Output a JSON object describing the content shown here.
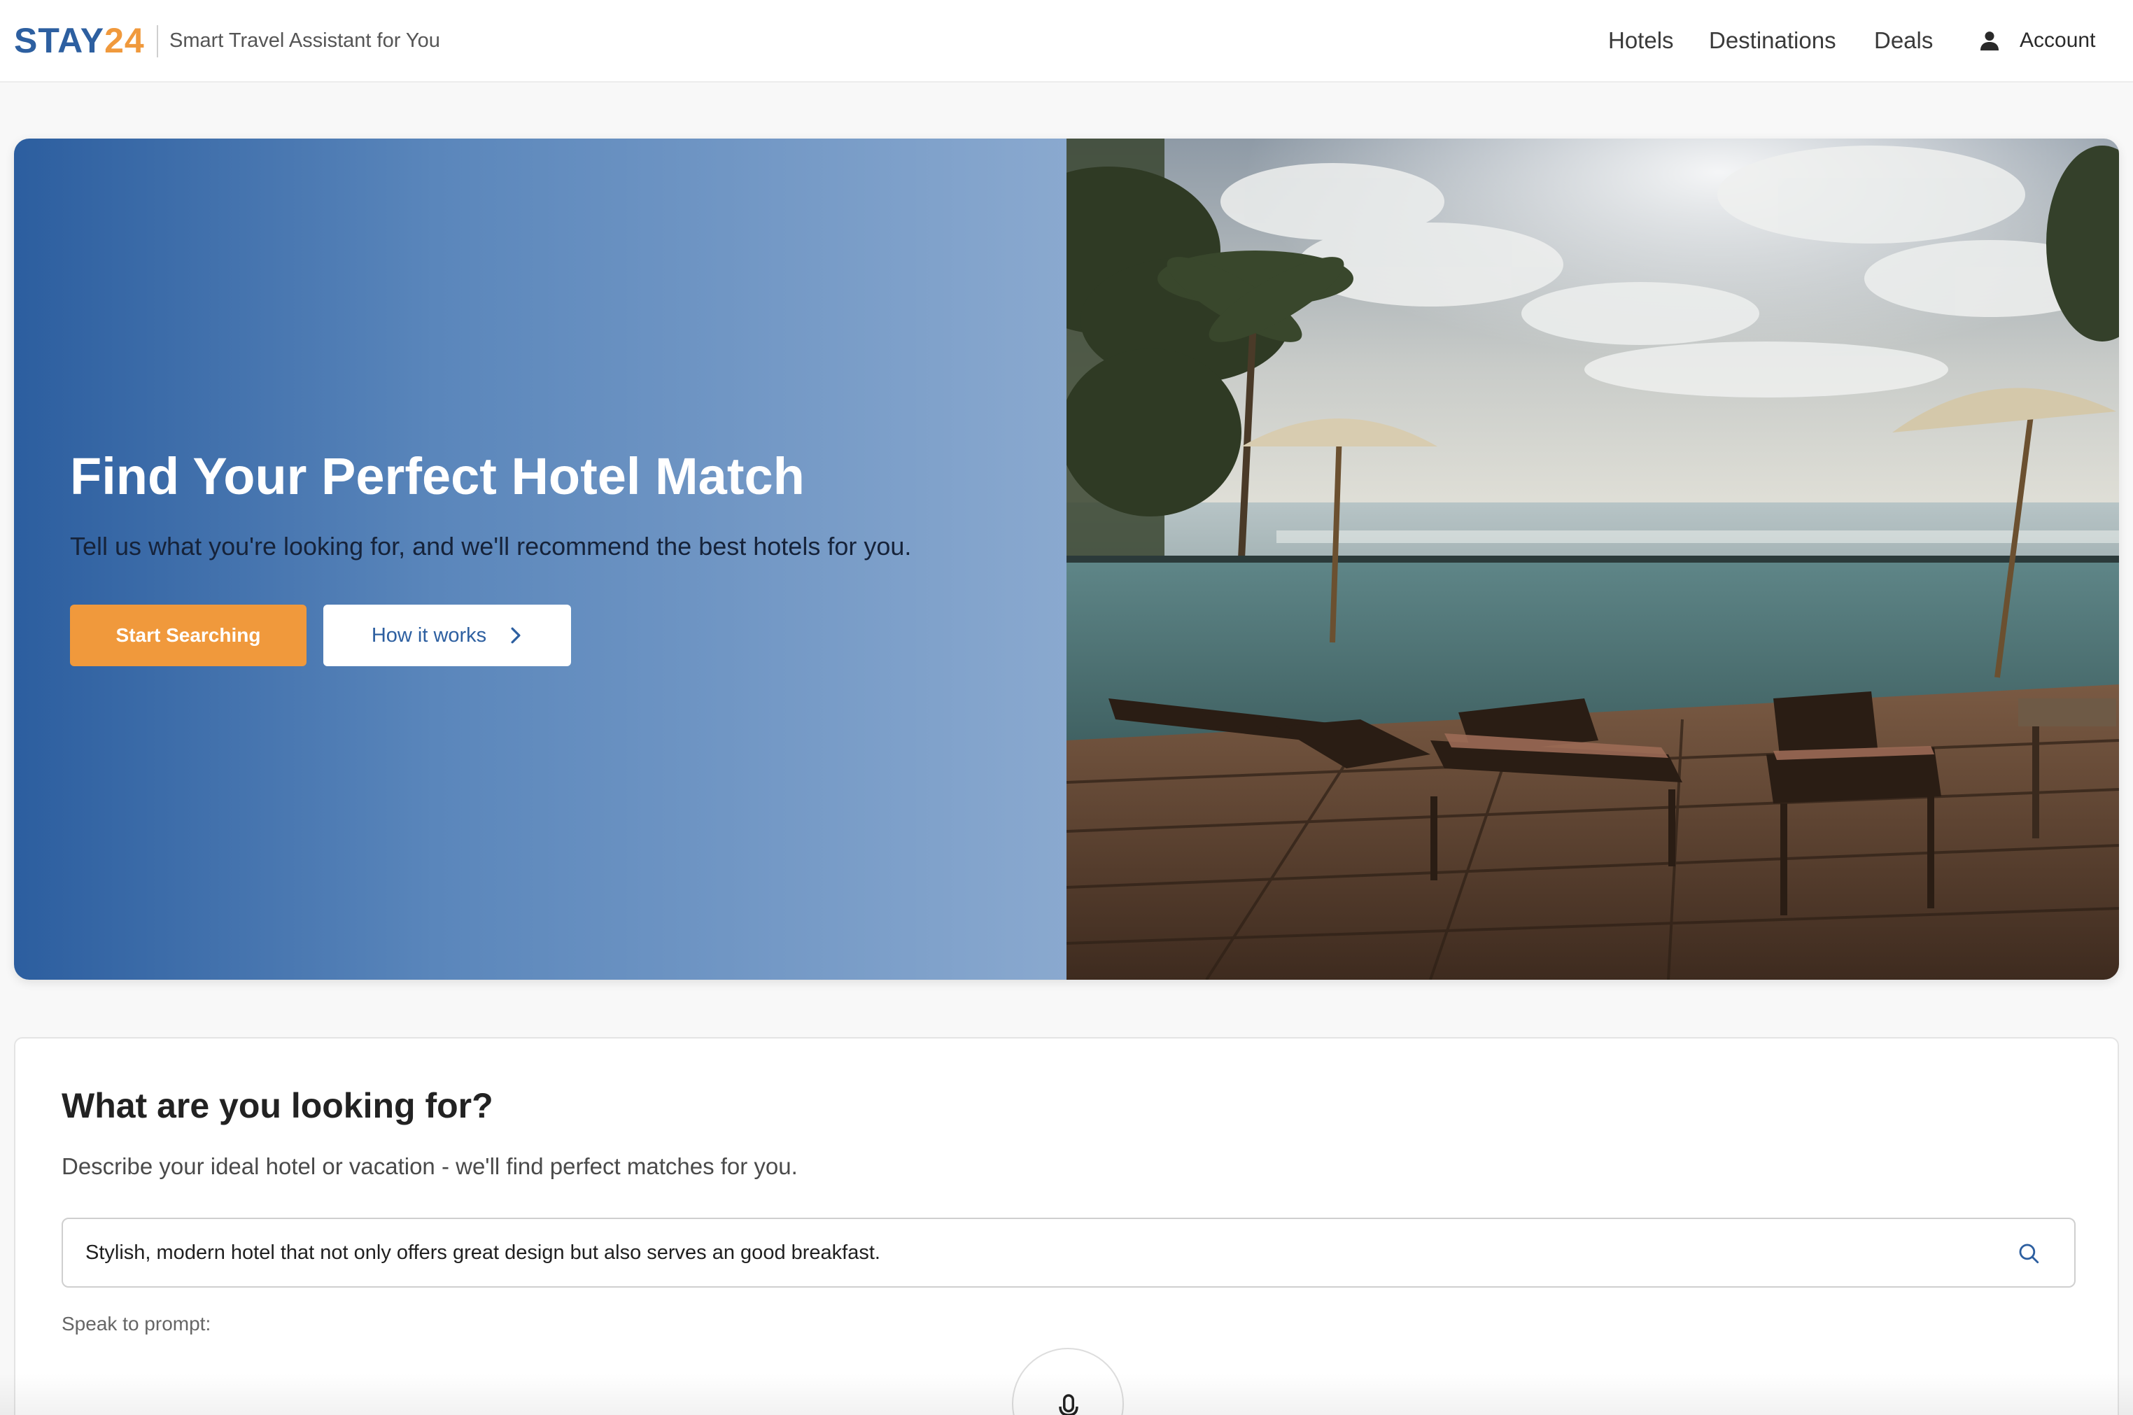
{
  "header": {
    "logo_part1": "STAY",
    "logo_part2": "24",
    "tagline": "Smart Travel Assistant for You",
    "nav": {
      "hotels": "Hotels",
      "destinations": "Destinations",
      "deals": "Deals"
    },
    "account_label": "Account",
    "account_icon": "user-icon"
  },
  "hero": {
    "title": "Find Your Perfect Hotel Match",
    "subtitle": "Tell us what you're looking for, and we'll recommend the best hotels for you.",
    "primary_button": "Start Searching",
    "secondary_button": "How it works",
    "secondary_button_icon": "chevron-right-icon",
    "image": "beach-resort-pool-deck-photo"
  },
  "search_card": {
    "title": "What are you looking for?",
    "description": "Describe your ideal hotel or vacation - we'll find perfect matches for you.",
    "input_value": "Stylish, modern hotel that not only offers great design but also serves an good breakfast.",
    "search_icon": "search-icon",
    "speak_label": "Speak to prompt:",
    "mic_icon": "microphone-icon"
  },
  "colors": {
    "brand_blue": "#2d5fa0",
    "brand_orange": "#f0993c",
    "hero_gradient_start": "#2c5e9f",
    "hero_gradient_end": "#8aa9cf"
  }
}
